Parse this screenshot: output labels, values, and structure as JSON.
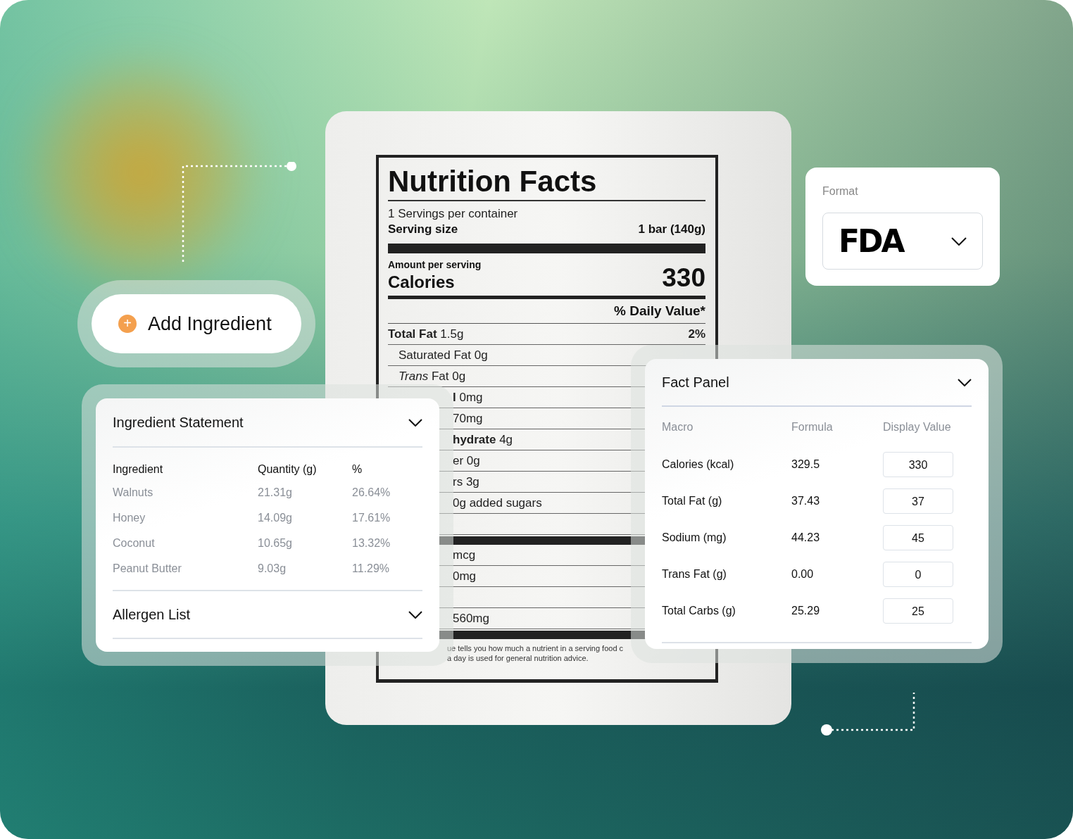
{
  "add_ingredient": {
    "label": "Add Ingredient",
    "icon": "+"
  },
  "nutrition_label": {
    "title": "Nutrition Facts",
    "servings": "1 Servings per container",
    "serving_size_label": "Serving size",
    "serving_size": "1 bar (140g)",
    "amount_label": "Amount per serving",
    "calories_label": "Calories",
    "calories": "330",
    "daily_value_header": "% Daily Value*",
    "rows": [
      {
        "kind": "full",
        "text": "**Total Fat** 1.5g",
        "dv": "2%"
      },
      {
        "kind": "sub",
        "text": "Saturated Fat 0g"
      },
      {
        "kind": "sub",
        "text": "*Trans* Fat 0g"
      },
      {
        "kind": "clipped",
        "text": "**l** 0mg"
      },
      {
        "kind": "clipped",
        "text": "70mg"
      },
      {
        "kind": "clipped",
        "text": "**hydrate** 4g"
      },
      {
        "kind": "clipped",
        "text": "er 0g"
      },
      {
        "kind": "clipped",
        "text": "rs 3g"
      },
      {
        "kind": "clipped",
        "text": "0g added sugars"
      },
      {
        "kind": "gap"
      },
      {
        "kind": "bar"
      },
      {
        "kind": "clipped",
        "text": "mcg"
      },
      {
        "kind": "clipped",
        "text": "0mg"
      },
      {
        "kind": "gap"
      },
      {
        "kind": "clipped",
        "text": "560mg"
      },
      {
        "kind": "bar"
      }
    ],
    "footnote": [
      "ue tells you how much a nutrient in a serving food c",
      "a day is used for general nutrition advice."
    ]
  },
  "format": {
    "label": "Format",
    "value": "FDA"
  },
  "ingredient_statement": {
    "title": "Ingredient Statement",
    "expanded": true,
    "columns": [
      "Ingredient",
      "Quantity (g)",
      "%"
    ],
    "rows": [
      [
        "Walnuts",
        "21.31g",
        "26.64%"
      ],
      [
        "Honey",
        "14.09g",
        "17.61%"
      ],
      [
        "Coconut",
        "10.65g",
        "13.32%"
      ],
      [
        "Peanut Butter",
        "9.03g",
        "11.29%"
      ]
    ]
  },
  "allergen_list": {
    "title": "Allergen List",
    "expanded": false
  },
  "fact_panel": {
    "title": "Fact Panel",
    "expanded": true,
    "columns": [
      "Macro",
      "Formula",
      "Display Value"
    ],
    "rows": [
      {
        "macro": "Calories (kcal)",
        "formula": "329.5",
        "display": "330"
      },
      {
        "macro": "Total Fat (g)",
        "formula": "37.43",
        "display": "37"
      },
      {
        "macro": "Sodium (mg)",
        "formula": "44.23",
        "display": "45"
      },
      {
        "macro": "Trans Fat (g)",
        "formula": "0.00",
        "display": "0"
      },
      {
        "macro": "Total Carbs  (g)",
        "formula": "25.29",
        "display": "25"
      }
    ]
  }
}
